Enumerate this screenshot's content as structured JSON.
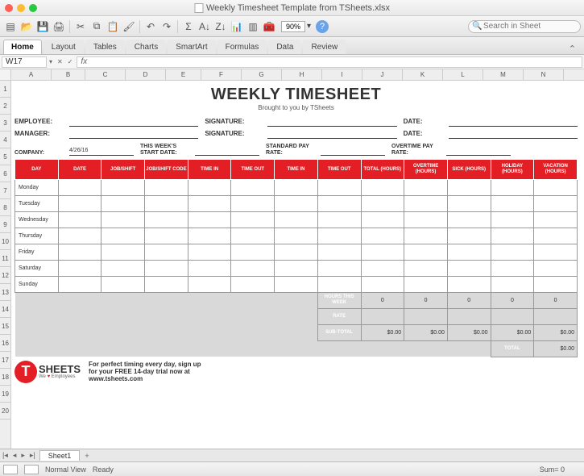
{
  "window": {
    "title": "Weekly Timesheet Template from TSheets.xlsx"
  },
  "toolbar": {
    "zoom": "90%",
    "search_placeholder": "Search in Sheet"
  },
  "ribbon": {
    "tabs": [
      "Home",
      "Layout",
      "Tables",
      "Charts",
      "SmartArt",
      "Formulas",
      "Data",
      "Review"
    ],
    "active": 0
  },
  "formula_bar": {
    "cell_ref": "W17",
    "fx": "fx",
    "value": ""
  },
  "columns": [
    "A",
    "B",
    "C",
    "D",
    "E",
    "F",
    "G",
    "H",
    "I",
    "J",
    "K",
    "L",
    "M",
    "N"
  ],
  "row_numbers": [
    "1",
    "2",
    "3",
    "4",
    "5",
    "6",
    "7",
    "8",
    "9",
    "10",
    "11",
    "12",
    "13",
    "14",
    "15",
    "16",
    "17",
    "18",
    "19",
    "20"
  ],
  "doc": {
    "title": "WEEKLY TIMESHEET",
    "subtitle": "Brought to you by TSheets",
    "labels": {
      "employee": "EMPLOYEE:",
      "signature": "SIGNATURE:",
      "date": "DATE:",
      "manager": "MANAGER:",
      "company": "COMPANY:",
      "company_date": "4/26/16",
      "this_week": "THIS WEEK'S START DATE:",
      "std_rate": "STANDARD PAY RATE:",
      "ot_rate": "OVERTIME PAY RATE:"
    },
    "headers": [
      "DAY",
      "DATE",
      "JOB/SHIFT",
      "JOB/SHIFT CODE",
      "TIME IN",
      "TIME OUT",
      "TIME IN",
      "TIME OUT",
      "TOTAL (HOURS)",
      "OVERTIME (HOURS)",
      "SICK (HOURS)",
      "HOLIDAY (HOURS)",
      "VACATION (HOURS)"
    ],
    "days": [
      "Monday",
      "Tuesday",
      "Wednesday",
      "Thursday",
      "Friday",
      "Saturday",
      "Sunday"
    ],
    "summary": {
      "hours_label": "HOURS THIS WEEK",
      "hours": [
        "0",
        "0",
        "0",
        "0",
        "0"
      ],
      "rate_label": "RATE",
      "rate": [
        "",
        "",
        "",
        "",
        ""
      ],
      "subtotal_label": "SUB-TOTAL",
      "subtotal": [
        "$0.00",
        "$0.00",
        "$0.00",
        "$0.00",
        "$0.00"
      ],
      "total_label": "TOTAL",
      "total": "$0.00"
    },
    "footer": {
      "brand_t": "T",
      "brand_rest": "SHEETS",
      "tagline_pre": "We ",
      "tagline_heart": "♥",
      "tagline_post": " Employees",
      "message_l1": "For perfect timing every day, sign up",
      "message_l2": "for your FREE 14-day trial now at",
      "message_l3": "www.tsheets.com"
    }
  },
  "sheet_tabs": {
    "active": "Sheet1"
  },
  "status": {
    "view": "Normal View",
    "ready": "Ready",
    "sum": "Sum= 0"
  }
}
